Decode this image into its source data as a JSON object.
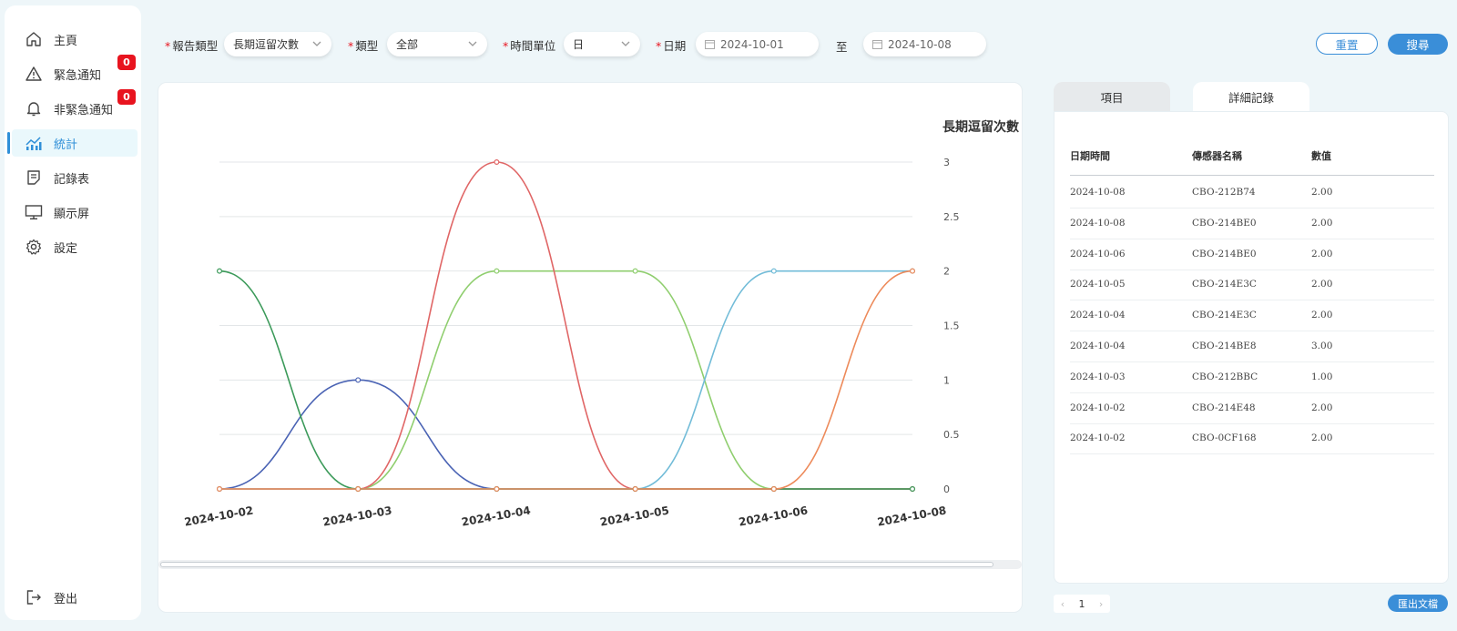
{
  "sidebar": {
    "items": [
      {
        "label": "主頁",
        "icon": "home-icon"
      },
      {
        "label": "緊急通知",
        "icon": "warning-icon",
        "badge": "0"
      },
      {
        "label": "非緊急通知",
        "icon": "bell-icon",
        "badge": "0"
      },
      {
        "label": "統計",
        "icon": "chart-icon",
        "active": true
      },
      {
        "label": "記錄表",
        "icon": "document-icon"
      },
      {
        "label": "顯示屏",
        "icon": "monitor-icon"
      },
      {
        "label": "設定",
        "icon": "gear-icon"
      }
    ],
    "logout": "登出"
  },
  "filters": {
    "report_type_label": "報告類型",
    "report_type_value": "長期逗留次數",
    "type_label": "類型",
    "type_value": "全部",
    "time_unit_label": "時間單位",
    "time_unit_value": "日",
    "date_label": "日期",
    "date_from": "2024-10-01",
    "date_to_label": "至",
    "date_to": "2024-10-08",
    "reset_label": "重置",
    "search_label": "搜尋"
  },
  "chart_data": {
    "type": "line",
    "y_axis_title": "長期逗留次數",
    "categories": [
      "2024-10-02",
      "2024-10-03",
      "2024-10-04",
      "2024-10-05",
      "2024-10-06",
      "2024-10-08"
    ],
    "yticks": [
      "0",
      "0.5",
      "1",
      "1.5",
      "2",
      "2.5",
      "3"
    ],
    "ylim": [
      0,
      3
    ],
    "smooth": true,
    "grid": true,
    "y_axis_side": "right",
    "series": [
      {
        "color": "#4a63b4",
        "values": [
          0,
          1,
          0,
          0,
          0,
          0
        ]
      },
      {
        "color": "#8fce6e",
        "values": [
          0,
          0,
          2,
          2,
          0,
          0
        ]
      },
      {
        "color": "#e06666",
        "values": [
          0,
          0,
          3,
          0,
          0,
          0
        ]
      },
      {
        "color": "#72bcd8",
        "values": [
          0,
          0,
          0,
          0,
          2,
          2
        ]
      },
      {
        "color": "#3c9a5a",
        "values": [
          2,
          0,
          0,
          0,
          0,
          0
        ]
      },
      {
        "color": "#ed8a5a",
        "values": [
          0,
          0,
          0,
          0,
          0,
          2
        ]
      }
    ]
  },
  "tabs": {
    "items_label": "項目",
    "detail_label": "詳細記錄"
  },
  "table": {
    "headers": [
      "日期時間",
      "傳感器名稱",
      "數值"
    ],
    "rows": [
      [
        "2024-10-08",
        "CBO-212B74",
        "2.00"
      ],
      [
        "2024-10-08",
        "CBO-214BE0",
        "2.00"
      ],
      [
        "2024-10-06",
        "CBO-214BE0",
        "2.00"
      ],
      [
        "2024-10-05",
        "CBO-214E3C",
        "2.00"
      ],
      [
        "2024-10-04",
        "CBO-214E3C",
        "2.00"
      ],
      [
        "2024-10-04",
        "CBO-214BE8",
        "3.00"
      ],
      [
        "2024-10-03",
        "CBO-212BBC",
        "1.00"
      ],
      [
        "2024-10-02",
        "CBO-214E48",
        "2.00"
      ],
      [
        "2024-10-02",
        "CBO-0CF168",
        "2.00"
      ]
    ]
  },
  "pagination": {
    "prev": "‹",
    "page": "1",
    "next": "›"
  },
  "export_label": "匯出文檔"
}
